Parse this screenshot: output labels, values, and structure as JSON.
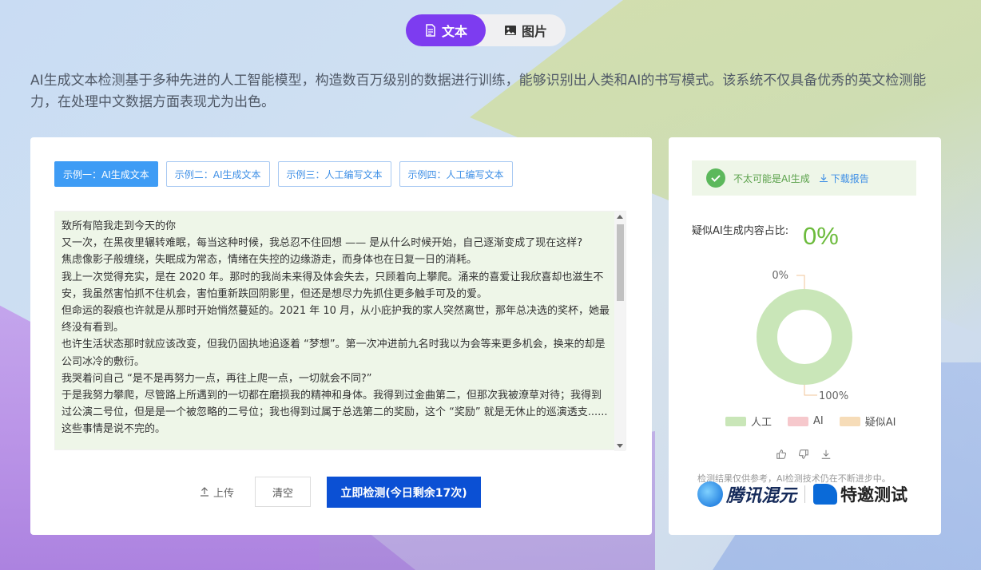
{
  "mode_toggle": {
    "text_label": "文本",
    "image_label": "图片"
  },
  "intro": "AI生成文本检测基于多种先进的人工智能模型，构造数百万级别的数据进行训练，能够识别出人类和AI的书写模式。该系统不仅具备优秀的英文检测能力，在处理中文数据方面表现尤为出色。",
  "examples": {
    "tabs": [
      {
        "label": "示例一：AI生成文本",
        "active": true
      },
      {
        "label": "示例二：AI生成文本",
        "active": false
      },
      {
        "label": "示例三：人工编写文本",
        "active": false
      },
      {
        "label": "示例四：人工编写文本",
        "active": false
      }
    ]
  },
  "input_text": "致所有陪我走到今天的你\n又一次，在黑夜里辗转难眠，每当这种时候，我总忍不住回想 —— 是从什么时候开始，自己逐渐变成了现在这样?\n焦虑像影子般缠绕，失眠成为常态，情绪在失控的边缘游走，而身体也在日复一日的消耗。\n我上一次觉得充实，是在 2020 年。那时的我尚未来得及体会失去，只顾着向上攀爬。涌来的喜爱让我欣喜却也滋生不安，我虽然害怕抓不住机会，害怕重新跌回阴影里，但还是想尽力先抓住更多触手可及的爱。\n但命运的裂痕也许就是从那时开始悄然蔓延的。2021 年 10 月，从小庇护我的家人突然离世，那年总决选的奖杯，她最终没有看到。\n也许生活状态那时就应该改变，但我仍固执地追逐着 “梦想”。第一次冲进前九名时我以为会等来更多机会，换来的却是公司冰冷的敷衍。\n我哭着问自己 “是不是再努力一点，再往上爬一点，一切就会不同?”\n于是我努力攀爬，尽管路上所遇到的一切都在磨损我的精神和身体。我得到过金曲第二，但那次我被潦草对待；我得到过公演二号位，但是是一个被忽略的二号位；我也得到过属于总选第二的奖励，这个 “奖励” 就是无休止的巡演透支...... 这些事情是说不完的。",
  "actions": {
    "upload_label": "上传",
    "clear_label": "清空",
    "detect_label": "立即检测(今日剩余17次)"
  },
  "result": {
    "verdict": "不太可能是AI生成",
    "download_label": "下载报告",
    "ratio_label": "疑似AI生成内容占比:",
    "ratio_value": "0%"
  },
  "chart_data": {
    "type": "pie",
    "categories": [
      "人工",
      "AI",
      "疑似AI"
    ],
    "values": [
      100,
      0,
      0
    ],
    "labels": [
      "100%",
      "0%"
    ],
    "colors": [
      "#c9e6b8",
      "#f6c8cc",
      "#f6dcb8"
    ],
    "legend_position": "bottom"
  },
  "disclaimer": "检测结果仅供参考，AI检测技术仍在不断进步中。",
  "brand": {
    "name": "腾讯混元",
    "badge": "特邀测试"
  }
}
